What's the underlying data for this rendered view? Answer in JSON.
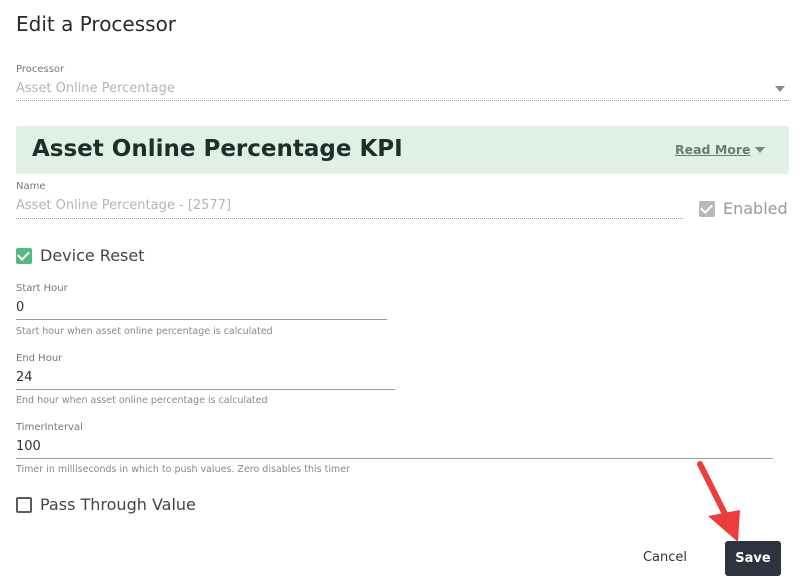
{
  "dialog": {
    "title": "Edit a Processor"
  },
  "processor": {
    "label": "Processor",
    "value": "Asset Online Percentage"
  },
  "banner": {
    "title": "Asset Online Percentage KPI",
    "read_more": "Read More"
  },
  "name_field": {
    "label": "Name",
    "value": "Asset Online Percentage  - [2577]"
  },
  "enabled": {
    "label": "Enabled",
    "checked": true
  },
  "device_reset": {
    "label": "Device Reset",
    "checked": true
  },
  "start_hour": {
    "label": "Start Hour",
    "value": "0",
    "hint": "Start hour when asset online percentage is calculated"
  },
  "end_hour": {
    "label": "End Hour",
    "value": "24",
    "hint": "End hour when asset online percentage is calculated"
  },
  "timer_interval": {
    "label": "TimerInterval",
    "value": "100",
    "hint": "Timer in milliseconds in which to push values. Zero disables this timer"
  },
  "pass_through": {
    "label": "Pass Through Value",
    "checked": false
  },
  "actions": {
    "cancel": "Cancel",
    "save": "Save"
  },
  "colors": {
    "banner_bg": "#e1f0e4",
    "check_green": "#56b883",
    "save_bg": "#2d3440",
    "annotation_arrow": "#ee3b3b"
  }
}
